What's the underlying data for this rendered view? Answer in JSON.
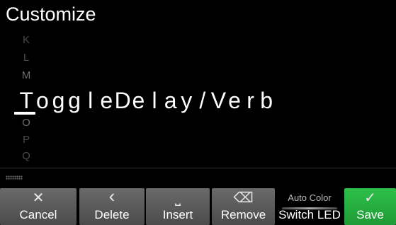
{
  "header": {
    "title": "Customize"
  },
  "char_picker": {
    "above": [
      "K",
      "L",
      "M"
    ],
    "below": [
      "O",
      "P",
      "Q"
    ]
  },
  "name_field": {
    "chars": [
      "T",
      "o",
      "g",
      "g",
      "l",
      "e",
      "D",
      "e",
      "l",
      "a",
      "y",
      "/",
      "V",
      "e",
      "r",
      "b"
    ]
  },
  "toolbar": {
    "cancel": {
      "icon": "close-icon",
      "glyph": "✕",
      "label": "Cancel"
    },
    "delete": {
      "icon": "chevron-left-icon",
      "glyph": "‹",
      "label": "Delete"
    },
    "insert": {
      "icon": "space-icon",
      "glyph": "⎵",
      "label": "Insert"
    },
    "remove": {
      "icon": "eraser-icon",
      "glyph": "⌫",
      "label": "Remove"
    },
    "switch_led": {
      "sublabel": "Auto Color",
      "label": "Switch LED"
    },
    "save": {
      "icon": "check-icon",
      "glyph": "✓",
      "label": "Save",
      "color": "#25ad3f"
    }
  }
}
